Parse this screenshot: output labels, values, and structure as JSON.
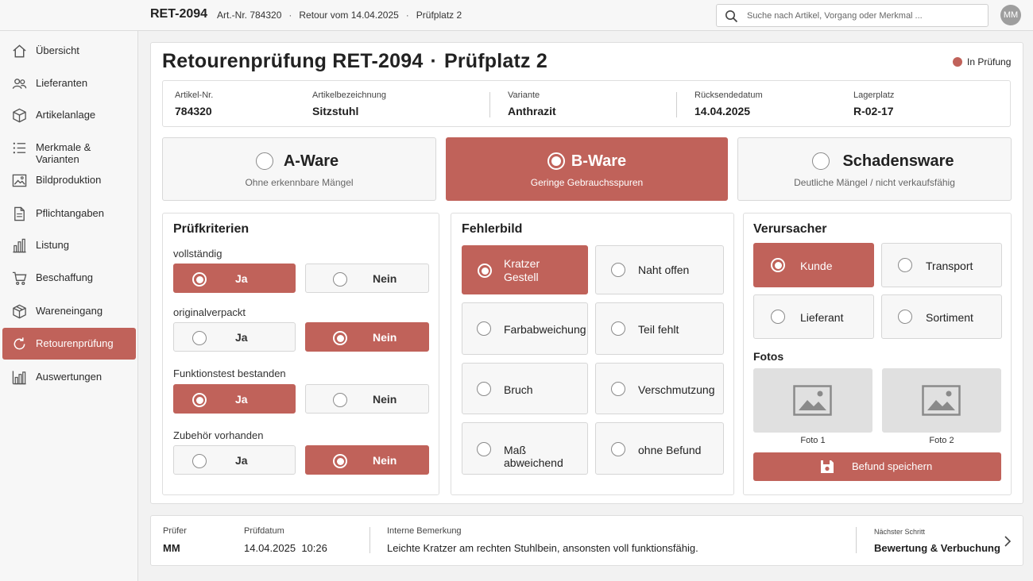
{
  "topbar": {
    "retour_id": "RET-2094",
    "crumbs": [
      "Art.-Nr. 784320",
      "Retour vom 14.04.2025",
      "Prüfplatz 2"
    ],
    "search_placeholder": "Suche nach Artikel, Vorgang oder Merkmal ...",
    "avatar": "MM"
  },
  "sidebar": {
    "items": [
      {
        "label": "Übersicht",
        "icon": "home-icon"
      },
      {
        "label": "Lieferanten",
        "icon": "users-icon"
      },
      {
        "label": "Artikelanlage",
        "icon": "box-icon"
      },
      {
        "label": "Merkmale & Varianten",
        "icon": "list-icon"
      },
      {
        "label": "Bildproduktion",
        "icon": "image-icon"
      },
      {
        "label": "Pflichtangaben",
        "icon": "document-icon"
      },
      {
        "label": "Listung",
        "icon": "bar-chart-icon"
      },
      {
        "label": "Beschaffung",
        "icon": "cart-icon"
      },
      {
        "label": "Wareneingang",
        "icon": "package-icon"
      },
      {
        "label": "Retourenprüfung",
        "icon": "refresh-icon",
        "active": true
      },
      {
        "label": "Auswertungen",
        "icon": "chart-icon"
      }
    ]
  },
  "header": {
    "title_main": "Retourenprüfung RET-2094",
    "title_sep": "·",
    "title_place": "Prüfplatz 2",
    "status": "In Prüfung",
    "status_color": "#c0625a"
  },
  "info": {
    "artikel_nr_label": "Artikel-Nr.",
    "artikel_nr": "784320",
    "bezeichnung_label": "Artikelbezeichnung",
    "bezeichnung": "Sitzstuhl",
    "variante_label": "Variante",
    "variante": "Anthrazit",
    "datum_label": "Rücksendedatum",
    "datum": "14.04.2025",
    "lager_label": "Lagerplatz",
    "lager": "R-02-17"
  },
  "grades": [
    {
      "title": "A-Ware",
      "subtitle": "Ohne erkennbare Mängel",
      "selected": false
    },
    {
      "title": "B-Ware",
      "subtitle": "Geringe Gebrauchsspuren",
      "selected": true
    },
    {
      "title": "Schadensware",
      "subtitle": "Deutliche Mängel / nicht verkaufsfähig",
      "selected": false
    }
  ],
  "pruefkriterien": {
    "title": "Prüfkriterien",
    "yes": "Ja",
    "no": "Nein",
    "questions": [
      {
        "label": "vollständig",
        "answer": "Ja"
      },
      {
        "label": "originalverpackt",
        "answer": "Nein"
      },
      {
        "label": "Funktionstest bestanden",
        "answer": "Ja"
      },
      {
        "label": "Zubehör vorhanden",
        "answer": "Nein"
      }
    ]
  },
  "fehlerbild": {
    "title": "Fehlerbild",
    "options": [
      {
        "label": "Kratzer",
        "label2": "Gestell",
        "selected": true
      },
      {
        "label": "Naht offen",
        "selected": false
      },
      {
        "label": "Farbabweichung",
        "selected": false
      },
      {
        "label": "Teil fehlt",
        "selected": false
      },
      {
        "label": "Bruch",
        "selected": false
      },
      {
        "label": "Verschmutzung",
        "selected": false
      },
      {
        "label": "Maß abweichend",
        "selected": false
      },
      {
        "label": "ohne Befund",
        "selected": false
      }
    ]
  },
  "verursacher": {
    "title": "Verursacher",
    "options": [
      {
        "label": "Kunde",
        "selected": true
      },
      {
        "label": "Transport",
        "selected": false
      },
      {
        "label": "Lieferant",
        "selected": false
      },
      {
        "label": "Sortiment",
        "selected": false
      }
    ]
  },
  "fotos": {
    "title": "Fotos",
    "items": [
      "Foto 1",
      "Foto 2"
    ]
  },
  "save_label": "Befund speichern",
  "footer": {
    "pruefer_label": "Prüfer",
    "pruefer": "MM",
    "datum_label": "Prüfdatum",
    "datum": "14.04.2025",
    "zeit": "10:26",
    "bemerkung_label": "Interne Bemerkung",
    "bemerkung": "Leichte Kratzer am rechten Stuhlbein, ansonsten voll funktionsfähig.",
    "next_label": "Nächster Schritt",
    "next": "Bewertung & Verbuchung"
  }
}
